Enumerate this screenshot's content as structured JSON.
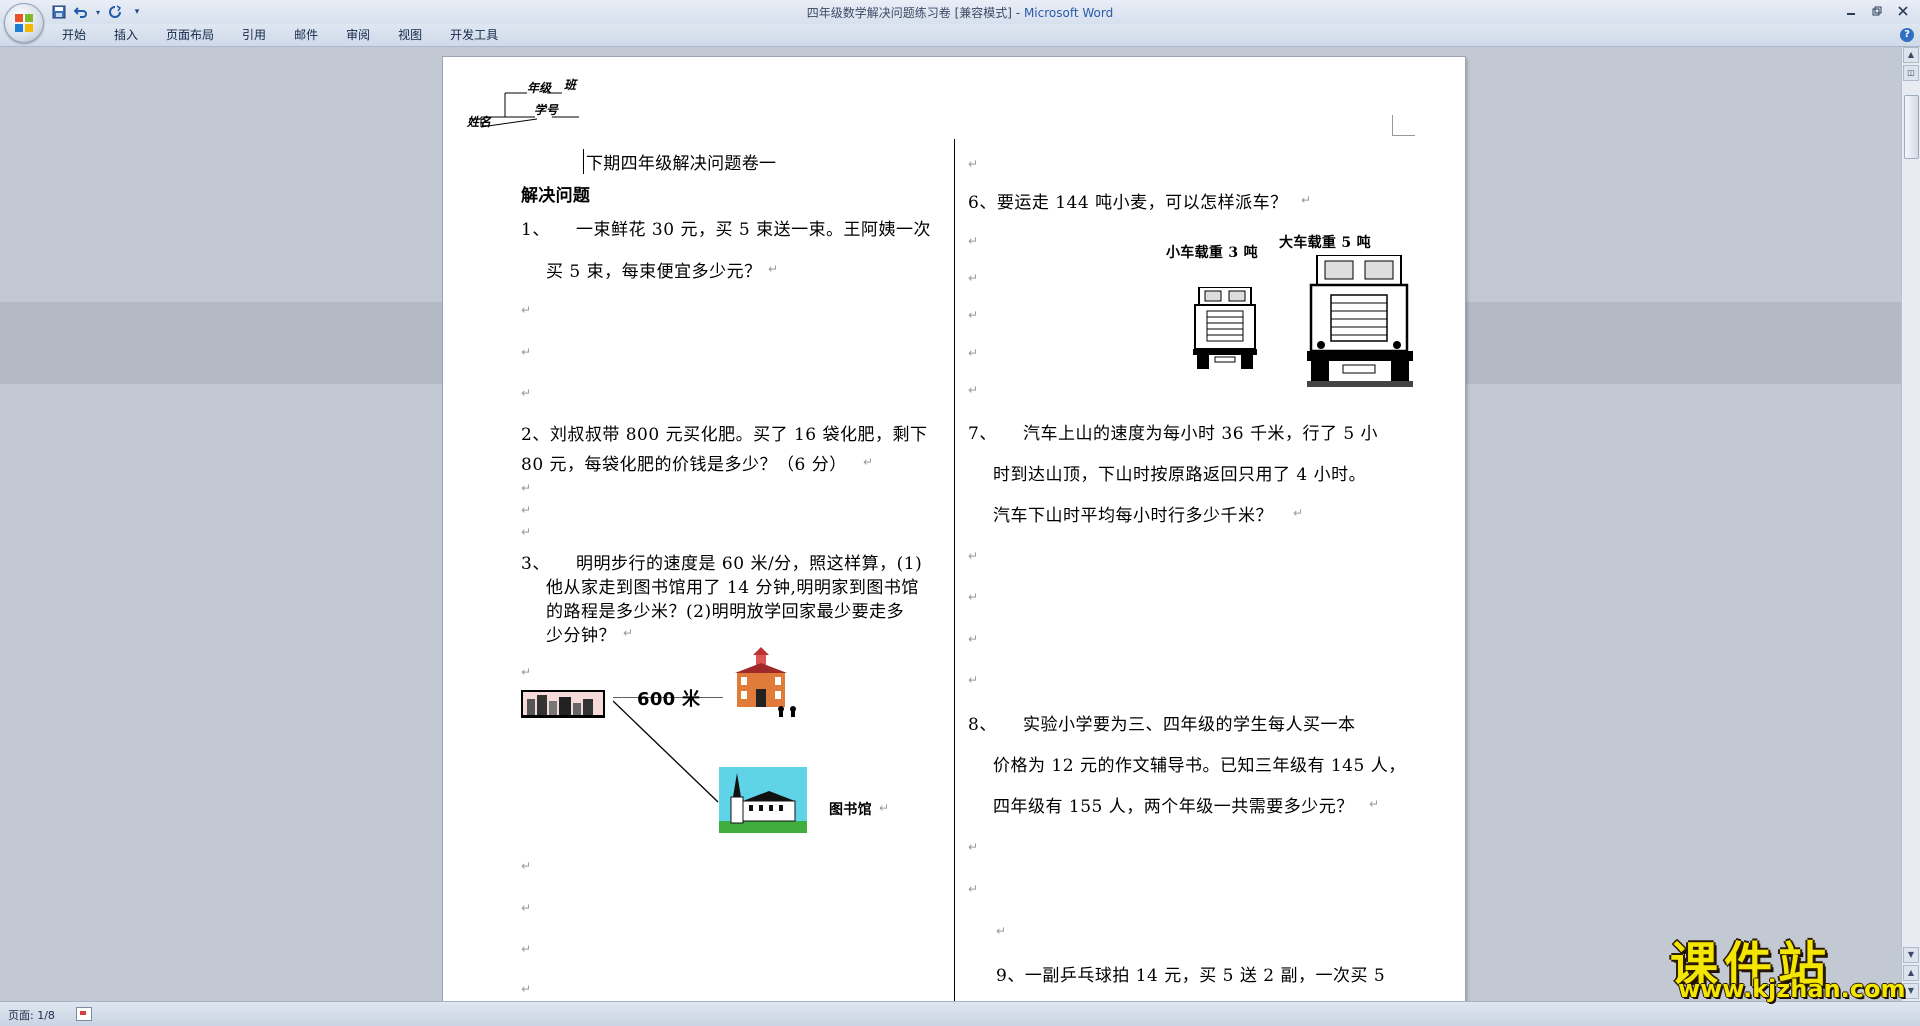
{
  "window": {
    "title": "四年级数学解决问题练习卷 [兼容模式]",
    "app_name": "Microsoft Word",
    "separator": " - "
  },
  "qat": {
    "save_icon": "save-icon",
    "undo_icon": "undo-icon",
    "redo_icon": "redo-icon",
    "customize_label": "▾"
  },
  "ribbon": {
    "tabs": [
      "开始",
      "插入",
      "页面布局",
      "引用",
      "邮件",
      "审阅",
      "视图",
      "开发工具"
    ]
  },
  "status": {
    "page": "页面: 1/8"
  },
  "doc": {
    "header": {
      "grade": "年级",
      "class": "班",
      "name": "姓名",
      "number": "学号"
    },
    "title": "下期四年级解决问题卷一",
    "section": "解决问题",
    "q1": {
      "num": "1、",
      "line1": "一束鲜花 30 元，买 5 束送一束。王阿姨一次",
      "line2": "买 5 束，每束便宜多少元？"
    },
    "q2": {
      "line1": "2、刘叔叔带 800  元买化肥。买了 16 袋化肥，剩下",
      "line2": "80 元，每袋化肥的价钱是多少？（6 分）"
    },
    "q3": {
      "num": "3、",
      "line1": "明明步行的速度是 60 米/分，照这样算，(1)",
      "line2": "他从家走到图书馆用了 14 分钟,明明家到图书馆",
      "line3": "的路程是多少米？(2)明明放学回家最少要走多",
      "line4": "少分钟？",
      "distance": "600 米",
      "library": "图书馆"
    },
    "q6": {
      "text": "6、要运走 144 吨小麦，可以怎样派车？",
      "small_truck": "小车载重 3 吨",
      "big_truck": "大车载重 5 吨"
    },
    "q7": {
      "num": "7、",
      "line1": "汽车上山的速度为每小时 36 千米，行了 5 小",
      "line2": "时到达山顶，下山时按原路返回只用了 4 小时。",
      "line3": "汽车下山时平均每小时行多少千米？"
    },
    "q8": {
      "num": "8、",
      "line1": "实验小学要为三、四年级的学生每人买一本",
      "line2": "价格为 12 元的作文辅导书。已知三年级有 145 人，",
      "line3": "四年级有 155 人，两个年级一共需要多少元？"
    },
    "q9": {
      "line1": "9、一副乒乓球拍 14 元，买 5  送 2 副，一次买 5"
    },
    "para_mark": "↵"
  },
  "watermark": {
    "text": "课件站",
    "url": "www.kjzhan.com"
  }
}
